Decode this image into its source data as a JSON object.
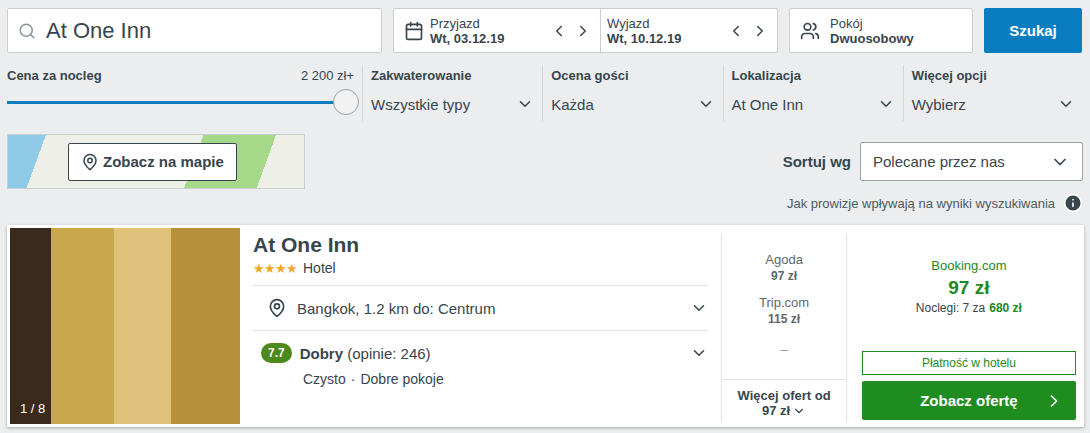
{
  "search": {
    "value": "At One Inn",
    "button": "Szukaj"
  },
  "dates": [
    {
      "label": "Przyjazd",
      "value": "Wt, 03.12.19",
      "prev": "<",
      "next": ">"
    },
    {
      "label": "Wyjazd",
      "value": "Wt, 10.12.19",
      "prev": "<",
      "next": ">"
    }
  ],
  "room": {
    "label": "Pokój",
    "value": "Dwuosobowy"
  },
  "price_filter": {
    "label": "Cena za nocleg",
    "value": "2 200 zł+",
    "level": 1.0
  },
  "filters": [
    {
      "label": "Zakwaterowanie",
      "value": "Wszystkie typy"
    },
    {
      "label": "Ocena gości",
      "value": "Każda"
    },
    {
      "label": "Lokalizacja",
      "value": "At One Inn"
    },
    {
      "label": "Więcej opcji",
      "value": "Wybierz"
    }
  ],
  "map_button": "Zobacz na mapie",
  "sort": {
    "label": "Sortuj wg",
    "value": "Polecane przez nas"
  },
  "commission_info": "Jak prowizje wpływają na wyniki wyszukiwania",
  "hotel": {
    "name": "At One Inn",
    "stars": 4,
    "type": "Hotel",
    "image_counter": "1 / 8",
    "location": "Bangkok, 1.2 km do: Centrum",
    "rating": {
      "score": "7.7",
      "label": "Dobry",
      "reviews": "(opinie: 246)"
    },
    "tags": [
      "Czysto",
      "Dobre pokoje"
    ],
    "tag_separator": "·",
    "offers": [
      {
        "site": "Agoda",
        "price": "97 zł"
      },
      {
        "site": "Trip.com",
        "price": "115 zł"
      }
    ],
    "offers_placeholder": "–",
    "more_offers": {
      "label": "Więcej ofert od",
      "price": "97 zł"
    },
    "best": {
      "site": "Booking.com",
      "price": "97 zł",
      "nights_label": "Noclegi: 7 za",
      "nights_total": "680 zł",
      "payment": "Płatność w hotelu",
      "button": "Zobacz ofertę"
    }
  }
}
